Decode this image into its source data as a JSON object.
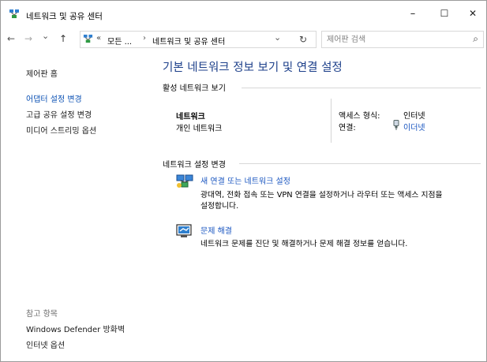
{
  "window": {
    "title": "네트워크 및 공유 센터",
    "minimize": "–",
    "maximize": "☐",
    "close": "✕"
  },
  "addressbar": {
    "back": "←",
    "forward": "→",
    "recent": "⌄",
    "up": "↑",
    "overflow": "«",
    "crumb_1": "모든 ...",
    "separator": "›",
    "crumb_2": "네트워크 및 공유 센터",
    "dropdown": "⌄",
    "refresh": "↻",
    "search_placeholder": "제어판 검색",
    "search_icon": "⌕"
  },
  "sidebar": {
    "home": "제어판 홈",
    "links": [
      "어댑터 설정 변경",
      "고급 공유 설정 변경",
      "미디어 스트리밍 옵션"
    ],
    "see_also_title": "참고 항목",
    "see_also": [
      "Windows Defender 방화벽",
      "인터넷 옵션"
    ]
  },
  "main": {
    "title": "기본 네트워크 정보 보기 및 연결 설정",
    "active_section": "활성 네트워크 보기",
    "network_name": "네트워크",
    "network_type": "개인 네트워크",
    "access_type_label": "액세스 형식:",
    "access_type_value": "인터넷",
    "connections_label": "연결:",
    "connection_value": "이더넷",
    "change_section": "네트워크 설정 변경",
    "task1_title": "새 연결 또는 네트워크 설정",
    "task1_desc_1": "광대역, 전화 접속 또는 VPN 연결을 설정하거나 라우터 또는 액세스 지점을",
    "task1_desc_2": "설정합니다.",
    "task2_title": "문제 해결",
    "task2_desc": "네트워크 문제를 진단 및 해결하거나 문제 해결 정보를 얻습니다."
  },
  "colors": {
    "heading": "#1c3f8a",
    "link": "#1a56c0"
  }
}
